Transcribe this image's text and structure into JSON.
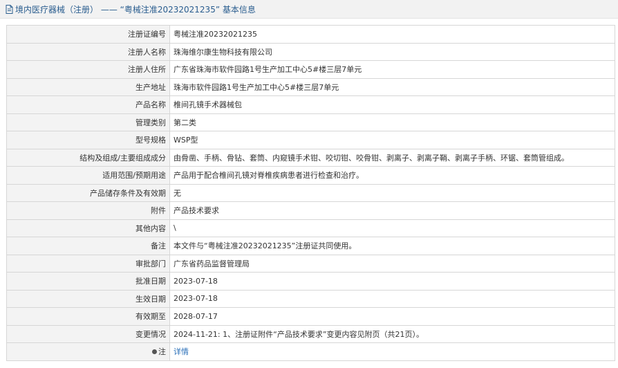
{
  "header": {
    "title": "境内医疗器械（注册） —— “粤械注准20232021235” 基本信息"
  },
  "rows": [
    {
      "label": "注册证编号",
      "value": "粤械注准20232021235"
    },
    {
      "label": "注册人名称",
      "value": "珠海维尔康生物科技有限公司"
    },
    {
      "label": "注册人住所",
      "value": "广东省珠海市软件园路1号生产加工中心5#楼三层7单元"
    },
    {
      "label": "生产地址",
      "value": "珠海市软件园路1号生产加工中心5#楼三层7单元"
    },
    {
      "label": "产品名称",
      "value": "椎间孔镜手术器械包"
    },
    {
      "label": "管理类别",
      "value": "第二类"
    },
    {
      "label": "型号规格",
      "value": "WSP型"
    },
    {
      "label": "结构及组成/主要组成成分",
      "value": "由骨凿、手柄、骨钻、套筒、内窥镜手术钳、咬切钳、咬骨钳、剥离子、剥离子鞘、剥离子手柄、环锯、套筒管组成。"
    },
    {
      "label": "适用范围/预期用途",
      "value": "产品用于配合椎间孔镜对脊椎疾病患者进行检查和治疗。"
    },
    {
      "label": "产品储存条件及有效期",
      "value": "无"
    },
    {
      "label": "附件",
      "value": "产品技术要求"
    },
    {
      "label": "其他内容",
      "value": "\\"
    },
    {
      "label": "备注",
      "value": "本文件与“粤械注准20232021235”注册证共同使用。"
    },
    {
      "label": "审批部门",
      "value": "广东省药品监督管理局"
    },
    {
      "label": "批准日期",
      "value": "2023-07-18"
    },
    {
      "label": "生效日期",
      "value": "2023-07-18"
    },
    {
      "label": "有效期至",
      "value": "2028-07-17"
    },
    {
      "label": "变更情况",
      "value": "2024-11-21: 1、注册证附件“产品技术要求”变更内容见附页（共21页）。"
    }
  ],
  "note_row": {
    "label": "注",
    "link": "详情"
  },
  "colors": {
    "header_text": "#2a5d8f",
    "link": "#2a6fb8",
    "label_bg": "#f3f3f3"
  }
}
